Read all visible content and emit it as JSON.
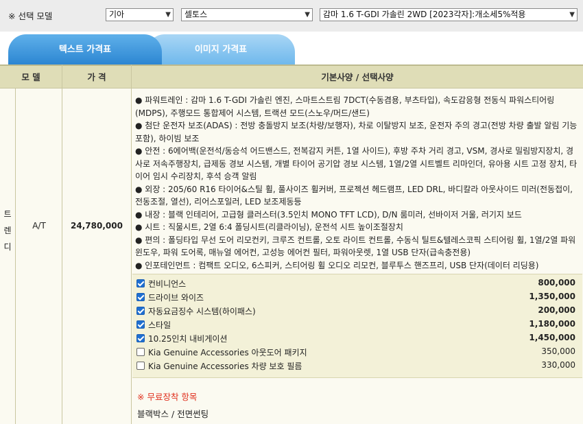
{
  "selector": {
    "label": "※ 선택 모델",
    "brand": "기아",
    "model": "셀토스",
    "trim": "감마 1.6 T-GDI 가솔린 2WD [2023각자]:개소세5%적용"
  },
  "tabs": [
    {
      "label": "텍스트 가격표"
    },
    {
      "label": "이미지 가격표"
    }
  ],
  "table": {
    "headers": {
      "model": "모 델",
      "price": "가 격",
      "spec": "기본사양 / 선택사양"
    },
    "trim_vertical": [
      "트",
      "렌",
      "디"
    ],
    "transmission": "A/T",
    "price": "24,780,000",
    "spec_lines": [
      "● 파워트레인 : 감마 1.6 T-GDI 가솔린 엔진, 스마트스트림 7DCT(수동겸용, 부츠타입), 속도감응형 전동식 파워스티어링(MDPS), 주행모드 통합제어 시스템, 트랙션 모드(스노우/머드/샌드)",
      "● 첨단 운전자 보조(ADAS) : 전방 충돌방지 보조(차량/보행자), 차로 이탈방지 보조, 운전자 주의 경고(전방 차량 출발 알림 기능 포함), 하이빔 보조",
      "● 안전 : 6에어백(운전석/동승석 어드밴스드, 전복감지 커튼, 1열 사이드), 후방 주차 거리 경고, VSM, 경사로 밀림방지장치, 경사로 저속주행장치, 급제동 경보 시스템, 개별 타이어 공기압 경보 시스템, 1열/2열 시트벨트 리마인더, 유아용 시트 고정 장치, 타이어 임시 수리장치, 후석 승객 알림",
      "● 외장 : 205/60 R16 타이어&스틸 휠, 풀사이즈 휠커버, 프로젝션 헤드램프, LED DRL, 바디칼라 아웃사이드 미러(전동접이, 전동조절, 열선), 리어스포일러, LED 보조제동등",
      "● 내장 : 블랙 인테리어, 고급형 클러스터(3.5인치 MONO TFT LCD), D/N 룸미러, 선바이저 거울, 러기지 보드",
      "● 시트 : 직물시트, 2열 6:4 폴딩시트(리클라이닝), 운전석 시트 높이조절장치",
      "● 편의 : 폴딩타입 무선 도어 리모컨키, 크루즈 컨트롤, 오토 라이트 컨트롤, 수동식 틸트&텔레스코픽 스티어링 휠, 1열/2열 파워윈도우, 파워 도어록, 매뉴얼 에어컨, 고성능 에어컨 필터, 파워아웃렛, 1열 USB 단자(급속충전용)",
      "● 인포테인먼트 : 컴팩트 오디오, 6스피커, 스티어링 휠 오디오 리모컨, 블루투스 핸즈프리, USB 단자(데이터 리딩용)"
    ],
    "options": [
      {
        "name": "컨비니언스",
        "price": "800,000",
        "checked": true
      },
      {
        "name": "드라이브 와이즈",
        "price": "1,350,000",
        "checked": true
      },
      {
        "name": "자동요금징수 시스템(하이패스)",
        "price": "200,000",
        "checked": true
      },
      {
        "name": "스타일",
        "price": "1,180,000",
        "checked": true
      },
      {
        "name": "10.25인치 내비게이션",
        "price": "1,450,000",
        "checked": true
      },
      {
        "name": "Kia Genuine Accessories 아웃도어 패키지",
        "price": "350,000",
        "checked": false
      },
      {
        "name": "Kia Genuine Accessories 차량 보호 필름",
        "price": "330,000",
        "checked": false
      }
    ],
    "free_title": "※ 무료장착 항목",
    "free_item": "블랙박스 / 전면썬팅"
  }
}
